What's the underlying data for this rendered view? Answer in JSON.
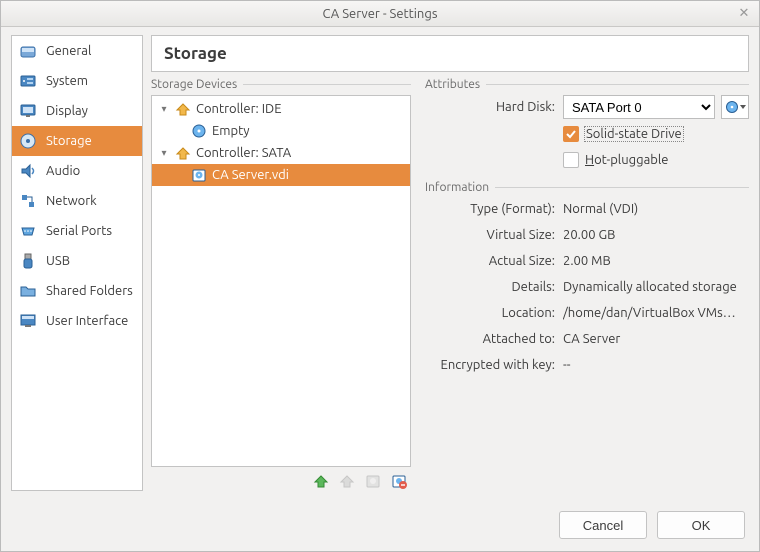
{
  "window": {
    "title": "CA Server - Settings"
  },
  "categories": [
    {
      "label": "General"
    },
    {
      "label": "System"
    },
    {
      "label": "Display"
    },
    {
      "label": "Storage"
    },
    {
      "label": "Audio"
    },
    {
      "label": "Network"
    },
    {
      "label": "Serial Ports"
    },
    {
      "label": "USB"
    },
    {
      "label": "Shared Folders"
    },
    {
      "label": "User Interface"
    }
  ],
  "page": {
    "title": "Storage"
  },
  "storage": {
    "section_label": "Storage Devices",
    "controllers": [
      {
        "label": "Controller: IDE",
        "children": [
          {
            "label": "Empty"
          }
        ]
      },
      {
        "label": "Controller: SATA",
        "children": [
          {
            "label": "CA Server.vdi",
            "selected": true
          }
        ]
      }
    ]
  },
  "attr": {
    "section_label": "Attributes",
    "hard_disk_label": "Hard Disk:",
    "hard_disk_value": "SATA Port 0",
    "ssd_label": "Solid-state Drive",
    "hotplug_prefix": "H",
    "hotplug_suffix": "ot-pluggable"
  },
  "info": {
    "section_label": "Information",
    "rows": [
      {
        "label": "Type (Format):",
        "value": "Normal (VDI)"
      },
      {
        "label": "Virtual Size:",
        "value": "20.00 GB"
      },
      {
        "label": "Actual Size:",
        "value": "2.00 MB"
      },
      {
        "label": "Details:",
        "value": "Dynamically allocated storage"
      },
      {
        "label": "Location:",
        "value": "/home/dan/VirtualBox VMs…"
      },
      {
        "label": "Attached to:",
        "value": "CA Server"
      },
      {
        "label": "Encrypted with key:",
        "value": "--"
      }
    ]
  },
  "footer": {
    "cancel": "Cancel",
    "ok": "OK"
  }
}
